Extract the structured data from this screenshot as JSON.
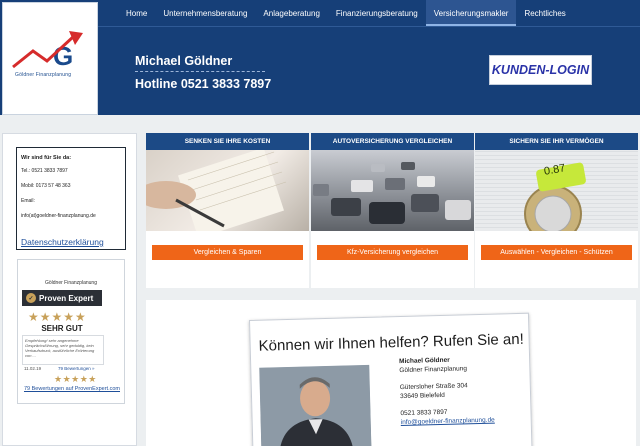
{
  "header": {
    "logo_text": "Göldner Finanzplanung",
    "nav": [
      {
        "label": "Home",
        "active": false
      },
      {
        "label": "Unternehmensberatung",
        "active": false
      },
      {
        "label": "Anlageberatung",
        "active": false
      },
      {
        "label": "Finanzierungsberatung",
        "active": false
      },
      {
        "label": "Versicherungsmakler",
        "active": true
      },
      {
        "label": "Rechtliches",
        "active": false
      }
    ],
    "name": "Michael Göldner",
    "hotline": "Hotline 0521 3833 7897",
    "login_label": "KUNDEN-LOGIN"
  },
  "sidebar": {
    "contact_title": "Wir sind für Sie da:",
    "tel": "Tel.: 0521 3833 7897",
    "mobil": "Mobil: 0173 57 48 363",
    "email_label": "Email:",
    "email": "info(at)goeldner-finanzplanung.de",
    "privacy_link": "Datenschutzerklärung",
    "provenexpert": {
      "company": "Göldner Finanzplanung",
      "brand": "Proven Expert",
      "stars": "★★★★★",
      "grade": "SEHR GUT",
      "quote": "Empfehlung! sehr angenehme Gesprächsführung, sehr geduldig, kein Verkaufsdruck, ausführliche Erörterung von ...",
      "date": "11.02.19",
      "count_link": "79 Bewertungen »",
      "stars_small": "★★★★★",
      "reviews_link": "79 Bewertungen auf ProvenExpert.com"
    }
  },
  "cards": [
    {
      "title": "SENKEN SIE IHRE KOSTEN",
      "button": "Vergleichen & Sparen"
    },
    {
      "title": "AUTOVERSICHERUNG VERGLEICHEN",
      "button": "Kfz-Versicherung vergleichen"
    },
    {
      "title": "SICHERN SIE IHR VERMÖGEN",
      "button": "Auswählen - Vergleichen - Schützen",
      "tag_text": "0.87"
    }
  ],
  "help": {
    "title": "Können wir Ihnen helfen? Rufen Sie an!",
    "name": "Michael Göldner",
    "company": "Göldner Finanzplanung",
    "street": "Gütersloher Straße 304",
    "city": "33649 Bielefeld",
    "phone": "0521 3833 7897",
    "email": "info@goeldner-finanzplanung.de"
  },
  "colors": {
    "header_bg": "#163f78",
    "card_header": "#1c4a86",
    "button_orange": "#ef6518",
    "login_text": "#2a33a8"
  }
}
